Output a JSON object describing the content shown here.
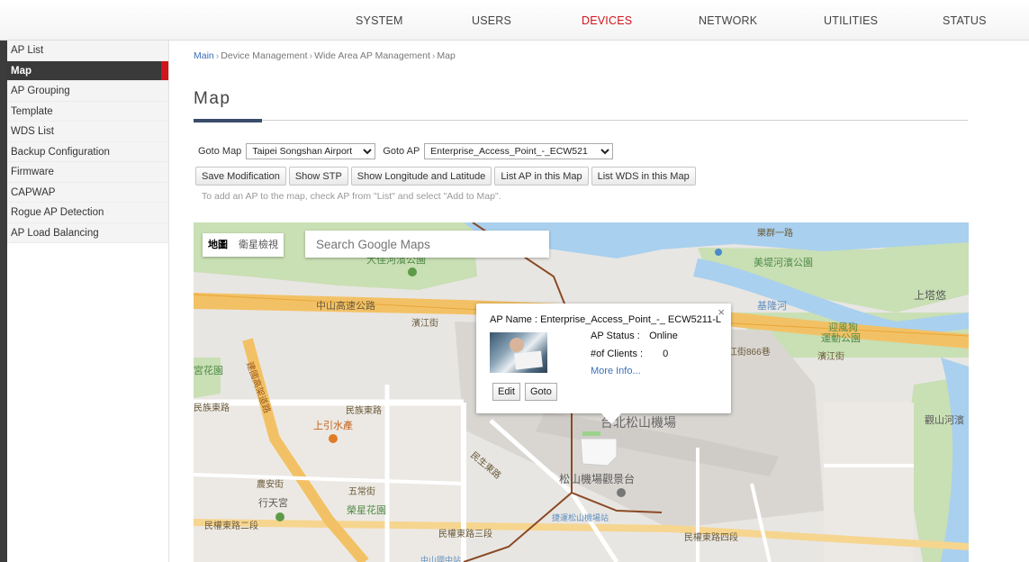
{
  "topnav": {
    "items": [
      {
        "label": "SYSTEM"
      },
      {
        "label": "USERS"
      },
      {
        "label": "DEVICES",
        "active": true
      },
      {
        "label": "NETWORK"
      },
      {
        "label": "UTILITIES"
      },
      {
        "label": "STATUS"
      }
    ]
  },
  "sidebar": {
    "items": [
      {
        "label": "AP List"
      },
      {
        "label": "Map",
        "active": true
      },
      {
        "label": "AP Grouping"
      },
      {
        "label": "Template"
      },
      {
        "label": "WDS List"
      },
      {
        "label": "Backup Configuration"
      },
      {
        "label": "Firmware"
      },
      {
        "label": "CAPWAP"
      },
      {
        "label": "Rogue AP Detection"
      },
      {
        "label": "AP Load Balancing"
      }
    ]
  },
  "breadcrumb": {
    "items": [
      "Main",
      "Device Management",
      "Wide Area AP Management",
      "Map"
    ],
    "separator": "›"
  },
  "page": {
    "title": "Map"
  },
  "goto": {
    "map_label": "Goto Map",
    "map_value": "Taipei Songshan Airport",
    "ap_label": "Goto AP",
    "ap_value": "Enterprise_Access_Point_-_ECW521"
  },
  "buttons": {
    "save": "Save Modification",
    "show_stp": "Show STP",
    "show_lon_lat": "Show Longitude and Latitude",
    "list_ap": "List AP in this Map",
    "list_wds": "List WDS in this Map"
  },
  "hint": "To add an AP to the map, check AP from \"List\" and select \"Add to Map\".",
  "map": {
    "type_map": "地圖",
    "type_satellite": "衛星檢視",
    "search_placeholder": "Search Google Maps",
    "labels": {
      "park_dajia": "大佳河濱公園",
      "park_meiti": "美堤河濱公園",
      "park_yingfeng": "迎風狗",
      "park_yingfeng2": "運動公園",
      "park_huayuan": "宮花園",
      "park_rongxing": "榮星花園",
      "river_keelung": "基隆河",
      "shangtayou": "上塔悠",
      "zhongshan_hwy": "中山高速公路",
      "binjiang": "濱江街",
      "binjiang2": "濱江街",
      "binjiang_lane": "江街866巷",
      "lequn": "樂群一路",
      "minzu": "民族東路",
      "minzu2": "民族東路",
      "shangyin": "上引水產",
      "nongan": "農安街",
      "wuchang": "五常街",
      "xingtian": "行天宮",
      "minquan2": "民權東路二段",
      "minquan3": "民權東路三段",
      "minquan4": "民權東路四段",
      "songshan_airport": "台北松山機場",
      "observation_deck": "松山機場觀景台",
      "mrt_songshan": "捷運松山機場站",
      "mrt_zhongshan": "中山國中站",
      "guanshan": "觀山河濱",
      "jianguo": "建國高架道路",
      "lizhou": "民生東路"
    }
  },
  "infowindow": {
    "close": "×",
    "ap_name_label": "AP Name :",
    "ap_name_value": "Enterprise_Access_Point_-_ ECW5211-L",
    "status_label": "AP Status :",
    "status_value": "Online",
    "clients_label": "#of Clients :",
    "clients_value": "0",
    "more_info": "More Info...",
    "edit": "Edit",
    "goto": "Goto"
  }
}
